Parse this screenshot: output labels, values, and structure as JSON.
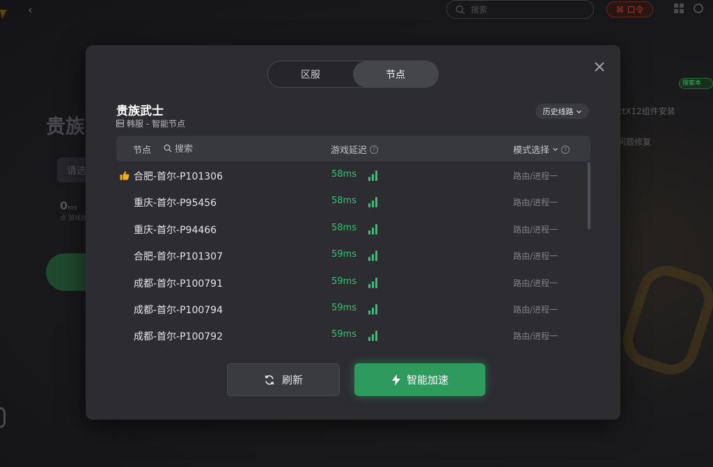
{
  "background": {
    "search_placeholder": "搜索",
    "vip_label": "口令",
    "game_title": "贵族",
    "select_placeholder": "请选",
    "ping_value": "0",
    "ping_unit": "ms",
    "ping_label": "点 游戏延",
    "side_badge": "搜索本",
    "side_item_1": "ctX12组件安装",
    "side_item_2": "问题修复"
  },
  "modal": {
    "tabs": [
      {
        "label": "区服"
      },
      {
        "label": "节点"
      }
    ],
    "active_tab": "节点",
    "game_name": "贵族武士",
    "region": "韩服 - 智能节点",
    "history_label": "历史线路",
    "table": {
      "col_node": "节点",
      "search_label": "搜索",
      "col_latency": "游戏延迟",
      "col_mode": "模式选择",
      "help_glyph": "?"
    },
    "rows": [
      {
        "name": "合肥-首尔-P101306",
        "latency": "58ms",
        "mode": "路由/进程一",
        "recommended": true
      },
      {
        "name": "重庆-首尔-P95456",
        "latency": "58ms",
        "mode": "路由/进程一",
        "recommended": false
      },
      {
        "name": "重庆-首尔-P94466",
        "latency": "58ms",
        "mode": "路由/进程一",
        "recommended": false
      },
      {
        "name": "合肥-首尔-P101307",
        "latency": "59ms",
        "mode": "路由/进程一",
        "recommended": false
      },
      {
        "name": "成都-首尔-P100791",
        "latency": "59ms",
        "mode": "路由/进程一",
        "recommended": false
      },
      {
        "name": "成都-首尔-P100794",
        "latency": "59ms",
        "mode": "路由/进程一",
        "recommended": false
      },
      {
        "name": "成都-首尔-P100792",
        "latency": "59ms",
        "mode": "路由/进程一",
        "recommended": false
      }
    ],
    "refresh_label": "刷新",
    "boost_label": "智能加速"
  },
  "colors": {
    "accent_green": "#2e9a5e",
    "latency_green": "#38c07a",
    "thumb_yellow": "#f2b01e",
    "modal_bg": "#2c2c31"
  },
  "icons": [
    "back-icon",
    "search-icon",
    "grid-icon",
    "user-icon",
    "close-icon",
    "server-icon",
    "chevron-down-icon",
    "help-icon",
    "thumbs-up-icon",
    "signal-icon",
    "refresh-icon",
    "lightning-icon"
  ]
}
